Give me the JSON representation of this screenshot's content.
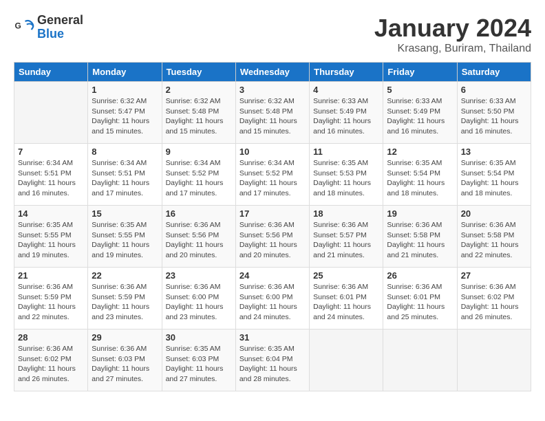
{
  "header": {
    "logo_line1": "General",
    "logo_line2": "Blue",
    "month": "January 2024",
    "location": "Krasang, Buriram, Thailand"
  },
  "days_of_week": [
    "Sunday",
    "Monday",
    "Tuesday",
    "Wednesday",
    "Thursday",
    "Friday",
    "Saturday"
  ],
  "weeks": [
    [
      {
        "day": "",
        "sunrise": "",
        "sunset": "",
        "daylight": ""
      },
      {
        "day": "1",
        "sunrise": "6:32 AM",
        "sunset": "5:47 PM",
        "daylight": "11 hours and 15 minutes."
      },
      {
        "day": "2",
        "sunrise": "6:32 AM",
        "sunset": "5:48 PM",
        "daylight": "11 hours and 15 minutes."
      },
      {
        "day": "3",
        "sunrise": "6:32 AM",
        "sunset": "5:48 PM",
        "daylight": "11 hours and 15 minutes."
      },
      {
        "day": "4",
        "sunrise": "6:33 AM",
        "sunset": "5:49 PM",
        "daylight": "11 hours and 16 minutes."
      },
      {
        "day": "5",
        "sunrise": "6:33 AM",
        "sunset": "5:49 PM",
        "daylight": "11 hours and 16 minutes."
      },
      {
        "day": "6",
        "sunrise": "6:33 AM",
        "sunset": "5:50 PM",
        "daylight": "11 hours and 16 minutes."
      }
    ],
    [
      {
        "day": "7",
        "sunrise": "6:34 AM",
        "sunset": "5:51 PM",
        "daylight": "11 hours and 16 minutes."
      },
      {
        "day": "8",
        "sunrise": "6:34 AM",
        "sunset": "5:51 PM",
        "daylight": "11 hours and 17 minutes."
      },
      {
        "day": "9",
        "sunrise": "6:34 AM",
        "sunset": "5:52 PM",
        "daylight": "11 hours and 17 minutes."
      },
      {
        "day": "10",
        "sunrise": "6:34 AM",
        "sunset": "5:52 PM",
        "daylight": "11 hours and 17 minutes."
      },
      {
        "day": "11",
        "sunrise": "6:35 AM",
        "sunset": "5:53 PM",
        "daylight": "11 hours and 18 minutes."
      },
      {
        "day": "12",
        "sunrise": "6:35 AM",
        "sunset": "5:54 PM",
        "daylight": "11 hours and 18 minutes."
      },
      {
        "day": "13",
        "sunrise": "6:35 AM",
        "sunset": "5:54 PM",
        "daylight": "11 hours and 18 minutes."
      }
    ],
    [
      {
        "day": "14",
        "sunrise": "6:35 AM",
        "sunset": "5:55 PM",
        "daylight": "11 hours and 19 minutes."
      },
      {
        "day": "15",
        "sunrise": "6:35 AM",
        "sunset": "5:55 PM",
        "daylight": "11 hours and 19 minutes."
      },
      {
        "day": "16",
        "sunrise": "6:36 AM",
        "sunset": "5:56 PM",
        "daylight": "11 hours and 20 minutes."
      },
      {
        "day": "17",
        "sunrise": "6:36 AM",
        "sunset": "5:56 PM",
        "daylight": "11 hours and 20 minutes."
      },
      {
        "day": "18",
        "sunrise": "6:36 AM",
        "sunset": "5:57 PM",
        "daylight": "11 hours and 21 minutes."
      },
      {
        "day": "19",
        "sunrise": "6:36 AM",
        "sunset": "5:58 PM",
        "daylight": "11 hours and 21 minutes."
      },
      {
        "day": "20",
        "sunrise": "6:36 AM",
        "sunset": "5:58 PM",
        "daylight": "11 hours and 22 minutes."
      }
    ],
    [
      {
        "day": "21",
        "sunrise": "6:36 AM",
        "sunset": "5:59 PM",
        "daylight": "11 hours and 22 minutes."
      },
      {
        "day": "22",
        "sunrise": "6:36 AM",
        "sunset": "5:59 PM",
        "daylight": "11 hours and 23 minutes."
      },
      {
        "day": "23",
        "sunrise": "6:36 AM",
        "sunset": "6:00 PM",
        "daylight": "11 hours and 23 minutes."
      },
      {
        "day": "24",
        "sunrise": "6:36 AM",
        "sunset": "6:00 PM",
        "daylight": "11 hours and 24 minutes."
      },
      {
        "day": "25",
        "sunrise": "6:36 AM",
        "sunset": "6:01 PM",
        "daylight": "11 hours and 24 minutes."
      },
      {
        "day": "26",
        "sunrise": "6:36 AM",
        "sunset": "6:01 PM",
        "daylight": "11 hours and 25 minutes."
      },
      {
        "day": "27",
        "sunrise": "6:36 AM",
        "sunset": "6:02 PM",
        "daylight": "11 hours and 26 minutes."
      }
    ],
    [
      {
        "day": "28",
        "sunrise": "6:36 AM",
        "sunset": "6:02 PM",
        "daylight": "11 hours and 26 minutes."
      },
      {
        "day": "29",
        "sunrise": "6:36 AM",
        "sunset": "6:03 PM",
        "daylight": "11 hours and 27 minutes."
      },
      {
        "day": "30",
        "sunrise": "6:35 AM",
        "sunset": "6:03 PM",
        "daylight": "11 hours and 27 minutes."
      },
      {
        "day": "31",
        "sunrise": "6:35 AM",
        "sunset": "6:04 PM",
        "daylight": "11 hours and 28 minutes."
      },
      {
        "day": "",
        "sunrise": "",
        "sunset": "",
        "daylight": ""
      },
      {
        "day": "",
        "sunrise": "",
        "sunset": "",
        "daylight": ""
      },
      {
        "day": "",
        "sunrise": "",
        "sunset": "",
        "daylight": ""
      }
    ]
  ]
}
